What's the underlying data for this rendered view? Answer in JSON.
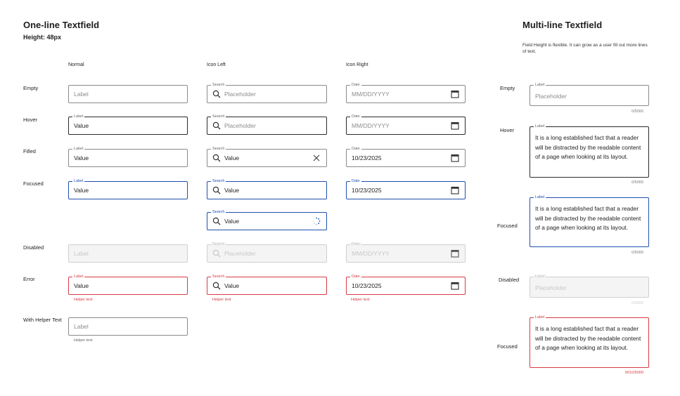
{
  "one_line": {
    "title": "One-line Textfield",
    "height_note": "Height: 48px",
    "columns": [
      "Normal",
      "Icon Left",
      "Icon Right"
    ],
    "rows": {
      "empty": "Empty",
      "hover": "Hover",
      "filled": "Filled",
      "focused": "Focused",
      "disabled": "Disabled",
      "error": "Error",
      "helper": "With Helper Text"
    },
    "normal": {
      "label": "Label",
      "value": "Value",
      "helper_text": "Helper text"
    },
    "icon_left": {
      "label": "Search",
      "placeholder": "Placeholder",
      "value": "Value",
      "helper_text": "Helper text"
    },
    "icon_right": {
      "label": "Date",
      "placeholder": "MM/DD/YYYY",
      "value": "10/23/2025",
      "helper_text": "Helper text"
    }
  },
  "multi_line": {
    "title": "Multi-line Textfield",
    "description": "Field Height is flexible. It can grow as a user fill out more lines of text.",
    "rows": {
      "empty": "Empty",
      "hover": "Hover",
      "focused": "Focused",
      "disabled": "Disabled",
      "error_focused": "Focused"
    },
    "label": "Label",
    "placeholder": "Placeholder",
    "value": "It is a long established fact that a reader will be distracted by the readable content of a page when looking at its layout.",
    "counter": "0/5000",
    "counter_error": "5010/5000"
  },
  "colors": {
    "focus": "#1f4fb0",
    "error": "#d83b45",
    "border": "#8a8a8a",
    "disabled_bg": "#f4f4f4"
  },
  "icons": {
    "search": "search-icon",
    "calendar": "calendar-icon",
    "clear": "close-icon",
    "loading": "spinner-icon"
  }
}
